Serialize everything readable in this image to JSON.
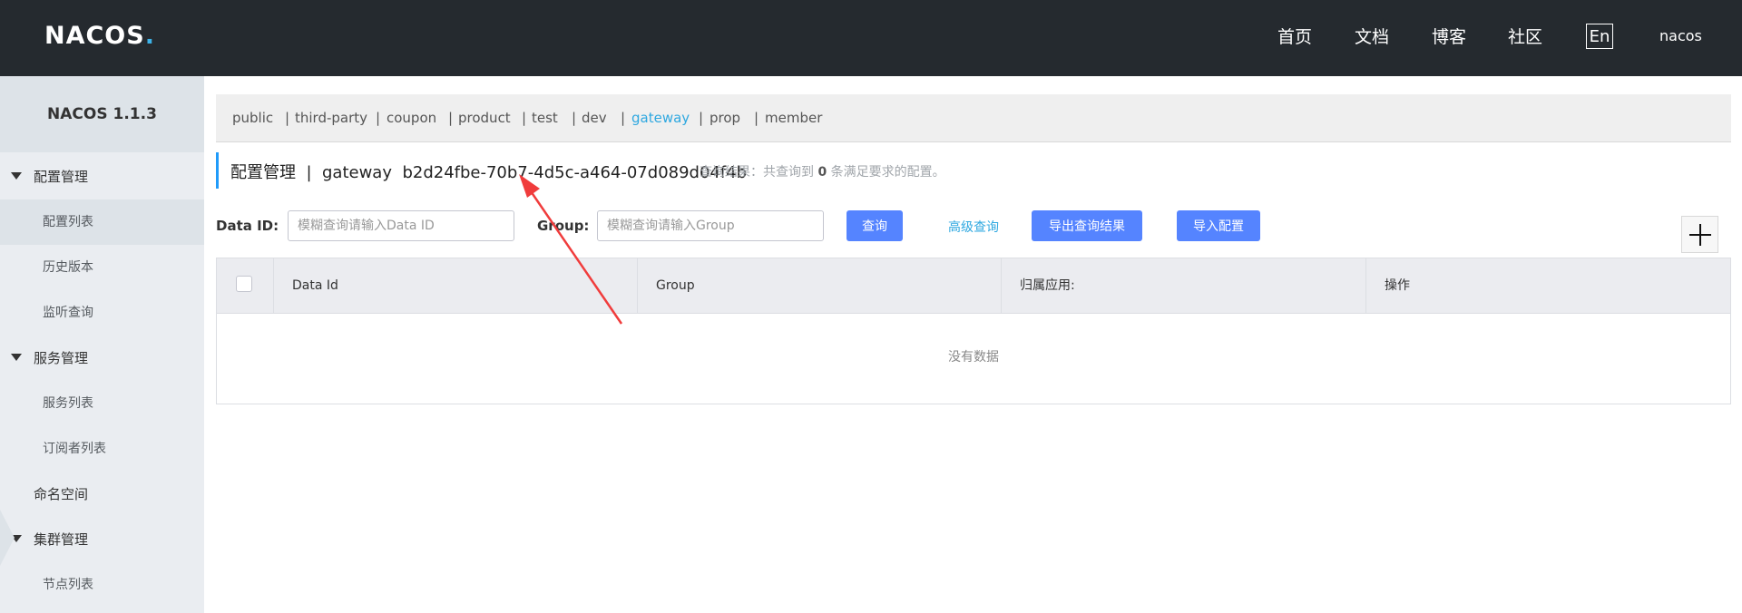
{
  "header": {
    "logo": "NACOS",
    "logo_dot": ".",
    "nav": [
      "首页",
      "文档",
      "博客",
      "社区"
    ],
    "lang": "En",
    "user": "nacos"
  },
  "sidebar": {
    "title": "NACOS 1.1.3",
    "groups": [
      {
        "label": "配置管理",
        "items": [
          "配置列表",
          "历史版本",
          "监听查询"
        ]
      },
      {
        "label": "服务管理",
        "items": [
          "服务列表",
          "订阅者列表"
        ]
      },
      {
        "label": "命名空间"
      },
      {
        "label": "集群管理",
        "items": [
          "节点列表"
        ]
      }
    ]
  },
  "namespaces": {
    "items": [
      "public",
      "third-party",
      "coupon",
      "product",
      "test",
      "dev",
      "gateway",
      "prop",
      "member"
    ],
    "separator": "|",
    "active": "gateway"
  },
  "title": {
    "section": "配置管理",
    "separator": "|",
    "namespace": "gateway",
    "namespace_id": "b2d24fbe-70b7-4d5c-a464-07d089d04f4b",
    "result_prefix": "查询结果：共查询到",
    "result_count": "0",
    "result_suffix": "条满足要求的配置。"
  },
  "search": {
    "data_id_label": "Data ID:",
    "data_id_placeholder": "模糊查询请输入Data ID",
    "group_label": "Group:",
    "group_placeholder": "模糊查询请输入Group",
    "query_button": "查询",
    "advanced_link": "高级查询",
    "export_button": "导出查询结果",
    "import_button": "导入配置"
  },
  "table": {
    "columns": [
      "Data Id",
      "Group",
      "归属应用:",
      "操作"
    ],
    "empty": "没有数据"
  },
  "colors": {
    "header_bg": "#252a2f",
    "accent": "#5584ff",
    "link": "#2fa8e0",
    "annotation_arrow": "#f03c3c"
  }
}
